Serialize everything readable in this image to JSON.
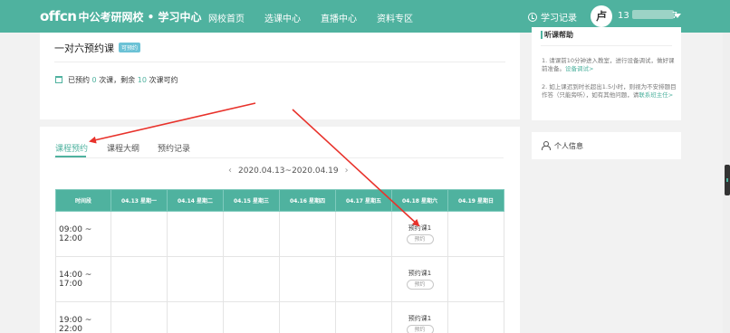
{
  "header": {
    "logo_brand": "offcn",
    "logo_text": "中公考研网校 • 学习中心",
    "nav": [
      "网校首页",
      "选课中心",
      "直播中心",
      "资料专区"
    ],
    "history_label": "学习记录",
    "avatar_char": "卢",
    "user_prefix": "13",
    "user_suffix": "7"
  },
  "course": {
    "title": "一对六预约课",
    "badge": "可预约",
    "stat_prefix": "已预约",
    "booked": "0",
    "stat_mid": "次课，剩余",
    "remaining": "10",
    "stat_suffix": "次课可约"
  },
  "tabs": [
    "课程预约",
    "课程大纲",
    "预约记录"
  ],
  "date_range": "2020.04.13~2020.04.19",
  "schedule": {
    "columns": [
      "时间段",
      "04.13 星期一",
      "04.14 星期二",
      "04.15 星期三",
      "04.16 星期四",
      "04.17 星期五",
      "04.18 星期六",
      "04.19 星期日"
    ],
    "rows": [
      {
        "time": "09:00 ~ 12:00",
        "slot_label": "预约课1",
        "slot_button": "预约"
      },
      {
        "time": "14:00 ~ 17:00",
        "slot_label": "预约课1",
        "slot_button": "预约"
      },
      {
        "time": "19:00 ~ 22:00",
        "slot_label": "预约课1",
        "slot_button": "预约"
      }
    ]
  },
  "sidebar": {
    "help_title": "听课帮助",
    "tip1": "1. 请课前10分钟进入教室，进行设备调试，做好课前准备。",
    "tip1_link": "设备调试>",
    "tip2": "2. 如上课迟到时长超出1.5小时，则视为不安排题目作答（只能旁听），如有其他问题，请",
    "tip2_link": "联系班主任>",
    "personal_label": "个人信息"
  },
  "colors": {
    "brand": "#4fb29f",
    "annotation_arrow": "#e8322b"
  }
}
